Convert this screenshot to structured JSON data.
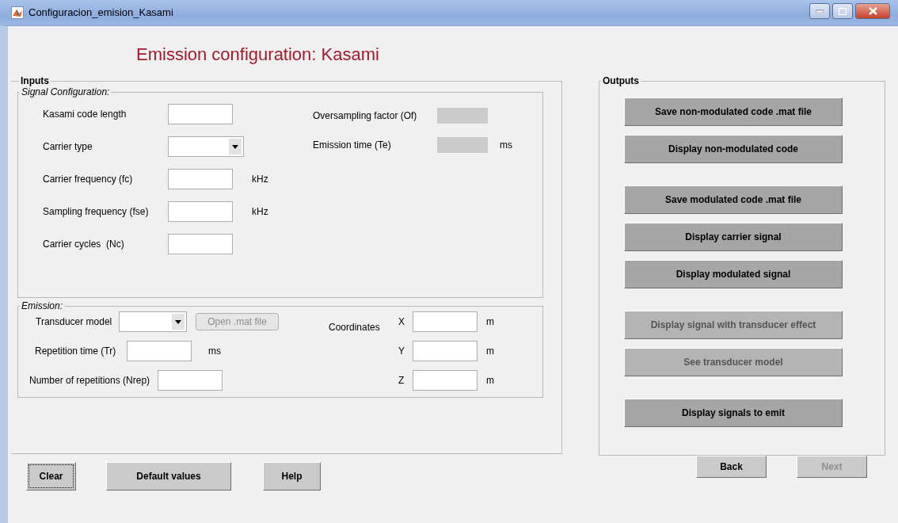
{
  "window": {
    "title": "Configuracion_emision_Kasami"
  },
  "heading": "Emission configuration: Kasami",
  "inputs": {
    "title": "Inputs",
    "signal_configuration": {
      "title": "Signal Configuration:",
      "fields": [
        {
          "label": "Kasami code length",
          "kind": "text"
        },
        {
          "label": "Carrier type",
          "kind": "dropdown"
        },
        {
          "label": "Carrier frequency (fc)",
          "kind": "text",
          "unit": "kHz"
        },
        {
          "label": "Sampling frequency (fse)",
          "kind": "text",
          "unit": "kHz"
        },
        {
          "label": "Carrier cycles  (Nc)",
          "kind": "text"
        }
      ],
      "results": [
        {
          "label": "Oversampling factor (Of)",
          "kind": "readout"
        },
        {
          "label": "Emission time (Te)",
          "kind": "readout",
          "unit": "ms"
        }
      ]
    },
    "emission": {
      "title": "Emission:",
      "transducer_model": {
        "label": "Transducer model"
      },
      "open_button": {
        "label": "Open .mat file",
        "disabled": true
      },
      "repetition_time": {
        "label": "Repetition time (Tr)",
        "unit": "ms"
      },
      "repetitions": {
        "label": "Number of repetitions (Nrep)"
      },
      "coordinates": {
        "label": "Coordinates",
        "axes": [
          {
            "label": "X",
            "unit": "m"
          },
          {
            "label": "Y",
            "unit": "m"
          },
          {
            "label": "Z",
            "unit": "m"
          }
        ]
      }
    }
  },
  "bottom_buttons": [
    {
      "label": "Clear",
      "focused": true
    },
    {
      "label": "Default values",
      "focused": false
    },
    {
      "label": "Help",
      "focused": false
    }
  ],
  "outputs": {
    "title": "Outputs",
    "button_groups": [
      [
        {
          "label": "Save non-modulated code .mat file",
          "disabled": false
        },
        {
          "label": "Display non-modulated code",
          "disabled": false
        }
      ],
      [
        {
          "label": "Save modulated code .mat file",
          "disabled": false
        },
        {
          "label": "Display carrier signal",
          "disabled": false
        },
        {
          "label": "Display modulated signal",
          "disabled": false
        }
      ],
      [
        {
          "label": "Display signal with transducer effect",
          "disabled": true
        },
        {
          "label": "See transducer model",
          "disabled": true
        }
      ],
      [
        {
          "label": "Display signals to emit",
          "disabled": false
        }
      ]
    ]
  },
  "navigation": [
    {
      "label": "Back",
      "disabled": false
    },
    {
      "label": "Next",
      "disabled": true
    }
  ]
}
